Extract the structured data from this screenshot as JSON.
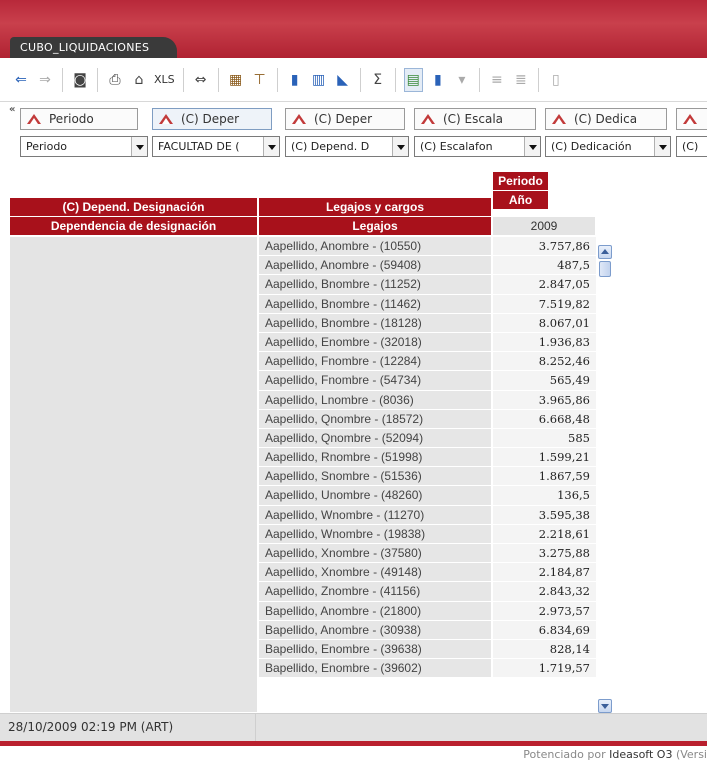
{
  "tab": {
    "title": "CUBO_LIQUIDACIONES"
  },
  "toolbar": {
    "xls_label": "XLS",
    "sigma": "Σ"
  },
  "dimensions": [
    {
      "label": "Periodo"
    },
    {
      "label": "(C) Deper"
    },
    {
      "label": "(C) Deper"
    },
    {
      "label": "(C) Escala"
    },
    {
      "label": "(C) Dedica"
    },
    {
      "label": ""
    }
  ],
  "filters": [
    {
      "value": "Periodo"
    },
    {
      "value": "FACULTAD DE ("
    },
    {
      "value": "(C) Depend. D"
    },
    {
      "value": "(C) Escalafon"
    },
    {
      "value": "(C) Dedicación"
    },
    {
      "value": "(C)"
    }
  ],
  "pivot": {
    "col_header_periodo": "Periodo",
    "col_header_anio": "Año",
    "row_header_dep": "(C) Depend. Designación",
    "row_header_legajos_cargos": "Legajos y cargos",
    "row_sub_dep": "Dependencia de designación",
    "row_sub_legajos": "Legajos",
    "year": "2009",
    "rows": [
      {
        "name": "Aapellido, Anombre - (10550)",
        "value": "3.757,86"
      },
      {
        "name": "Aapellido, Anombre - (59408)",
        "value": "487,5"
      },
      {
        "name": "Aapellido, Bnombre - (11252)",
        "value": "2.847,05"
      },
      {
        "name": "Aapellido, Bnombre - (11462)",
        "value": "7.519,82"
      },
      {
        "name": "Aapellido, Bnombre - (18128)",
        "value": "8.067,01"
      },
      {
        "name": "Aapellido, Enombre - (32018)",
        "value": "1.936,83"
      },
      {
        "name": "Aapellido, Fnombre - (12284)",
        "value": "8.252,46"
      },
      {
        "name": "Aapellido, Fnombre - (54734)",
        "value": "565,49"
      },
      {
        "name": "Aapellido, Lnombre - (8036)",
        "value": "3.965,86"
      },
      {
        "name": "Aapellido, Qnombre - (18572)",
        "value": "6.668,48"
      },
      {
        "name": "Aapellido, Qnombre - (52094)",
        "value": "585"
      },
      {
        "name": "Aapellido, Rnombre - (51998)",
        "value": "1.599,21"
      },
      {
        "name": "Aapellido, Snombre - (51536)",
        "value": "1.867,59"
      },
      {
        "name": "Aapellido, Unombre - (48260)",
        "value": "136,5"
      },
      {
        "name": "Aapellido, Wnombre - (11270)",
        "value": "3.595,38"
      },
      {
        "name": "Aapellido, Wnombre - (19838)",
        "value": "2.218,61"
      },
      {
        "name": "Aapellido, Xnombre - (37580)",
        "value": "3.275,88"
      },
      {
        "name": "Aapellido, Xnombre - (49148)",
        "value": "2.184,87"
      },
      {
        "name": "Aapellido, Znombre - (41156)",
        "value": "2.843,32"
      },
      {
        "name": "Bapellido, Anombre - (21800)",
        "value": "2.973,57"
      },
      {
        "name": "Bapellido, Anombre - (30938)",
        "value": "6.834,69"
      },
      {
        "name": "Bapellido, Enombre - (39638)",
        "value": "828,14"
      },
      {
        "name": "Bapellido, Enombre - (39602)",
        "value": "1.719,57"
      }
    ]
  },
  "status": {
    "datetime": "28/10/2009 02:19 PM (ART)"
  },
  "footer": {
    "powered_prefix": "Potenciado por",
    "brand": "Ideasoft O3",
    "suffix": "(Versi"
  }
}
